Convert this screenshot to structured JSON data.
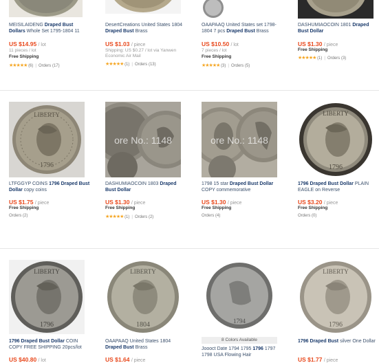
{
  "row1": [
    {
      "title_pre": "MEISILAIDENG ",
      "title_bold": "Draped Bust Dollars",
      "title_post": " Whole Set 1795-1804 11",
      "price": "US $14.95",
      "unit": "/ lot",
      "sub": "11 pieces / lot",
      "ship": "Free Shipping",
      "rating": "(6)",
      "orders": "Orders (17)"
    },
    {
      "title_pre": "DesertCreations United States 1804 ",
      "title_bold": "Draped Bust",
      "title_post": " Brass",
      "price": "US $1.03",
      "unit": "/ piece",
      "sub": "Shipping: US $0.27 / lot via Yanwen Economic Air Mail",
      "ship": "",
      "rating": "(1)",
      "orders": "Orders (13)"
    },
    {
      "title_pre": "OAAPAAQ United States set 1798-1804 7 pcs ",
      "title_bold": "Draped Bust",
      "title_post": " Brass",
      "price": "US $10.50",
      "unit": "/ lot",
      "sub": "7 pieces / lot",
      "ship": "Free Shipping",
      "rating": "(3)",
      "orders": "Orders (5)"
    },
    {
      "title_pre": "DASHUMIAOCOIN 1801 ",
      "title_bold": "Draped Bust Dollar",
      "title_post": "",
      "price": "US $1.30",
      "unit": "/ piece",
      "sub": "",
      "ship": "Free Shipping",
      "rating": "(1)",
      "orders": "Orders (3)"
    }
  ],
  "row2": [
    {
      "title_pre": "LTFGGYP COINS ",
      "title_bold": "1796 Draped Bust Dollar",
      "title_post": " copy coins",
      "price": "US $1.75",
      "unit": "/ piece",
      "ship": "Free Shipping",
      "rating": "",
      "orders": "Orders (2)",
      "coin_text": "1796",
      "watermark": ""
    },
    {
      "title_pre": "DASHUMIAOCOIN 1803 ",
      "title_bold": "Draped Bust Dollar",
      "title_post": "",
      "price": "US $1.30",
      "unit": "/ piece",
      "ship": "Free Shipping",
      "rating": "(1)",
      "orders": "Orders (2)",
      "coin_text": "",
      "watermark": "ore No.: 1148"
    },
    {
      "title_pre": "1798 15 star ",
      "title_bold": "Draped Bust Dollar",
      "title_post": " COPY commemorative",
      "price": "US $1.30",
      "unit": "/ piece",
      "ship": "Free Shipping",
      "rating": "",
      "orders": "Orders (4)",
      "coin_text": "",
      "watermark": "ore No.: 1148"
    },
    {
      "title_pre": "",
      "title_bold": "1796 Draped Bust Dollar",
      "title_post": " PLAIN EAGLE on Reverse",
      "price": "US $3.20",
      "unit": "/ piece",
      "ship": "Free Shipping",
      "rating": "",
      "orders": "Orders (0)",
      "coin_text": "1796",
      "watermark": ""
    }
  ],
  "row3": [
    {
      "title_pre": "",
      "title_bold": "1796 Draped Bust Dollar",
      "title_post": " COIN COPY FREE SHIPPING 20pcs/lot",
      "price": "US $40.80",
      "unit": "/ lot",
      "coin_text": "1796",
      "badge": ""
    },
    {
      "title_pre": "OAAPAAQ United States 1804 ",
      "title_bold": "Draped Bust",
      "title_post": " Brass",
      "price": "US $1.64",
      "unit": "/ piece",
      "coin_text": "1804",
      "badge": ""
    },
    {
      "title_pre": "Joooct Date 1794 1795 ",
      "title_bold": "1796",
      "title_post": " 1797 1798 USA Flowing Hair",
      "price": "",
      "unit": "",
      "coin_text": "1794",
      "badge": "8 Colors Available"
    },
    {
      "title_pre": "",
      "title_bold": "1796 Draped Bust",
      "title_post": " silver One Dollar",
      "price": "US $1.77",
      "unit": "/ piece",
      "coin_text": "1796",
      "badge": ""
    }
  ],
  "colors": {
    "price": "#e8491d",
    "star": "#f5a623",
    "link": "#1a3a6b"
  }
}
